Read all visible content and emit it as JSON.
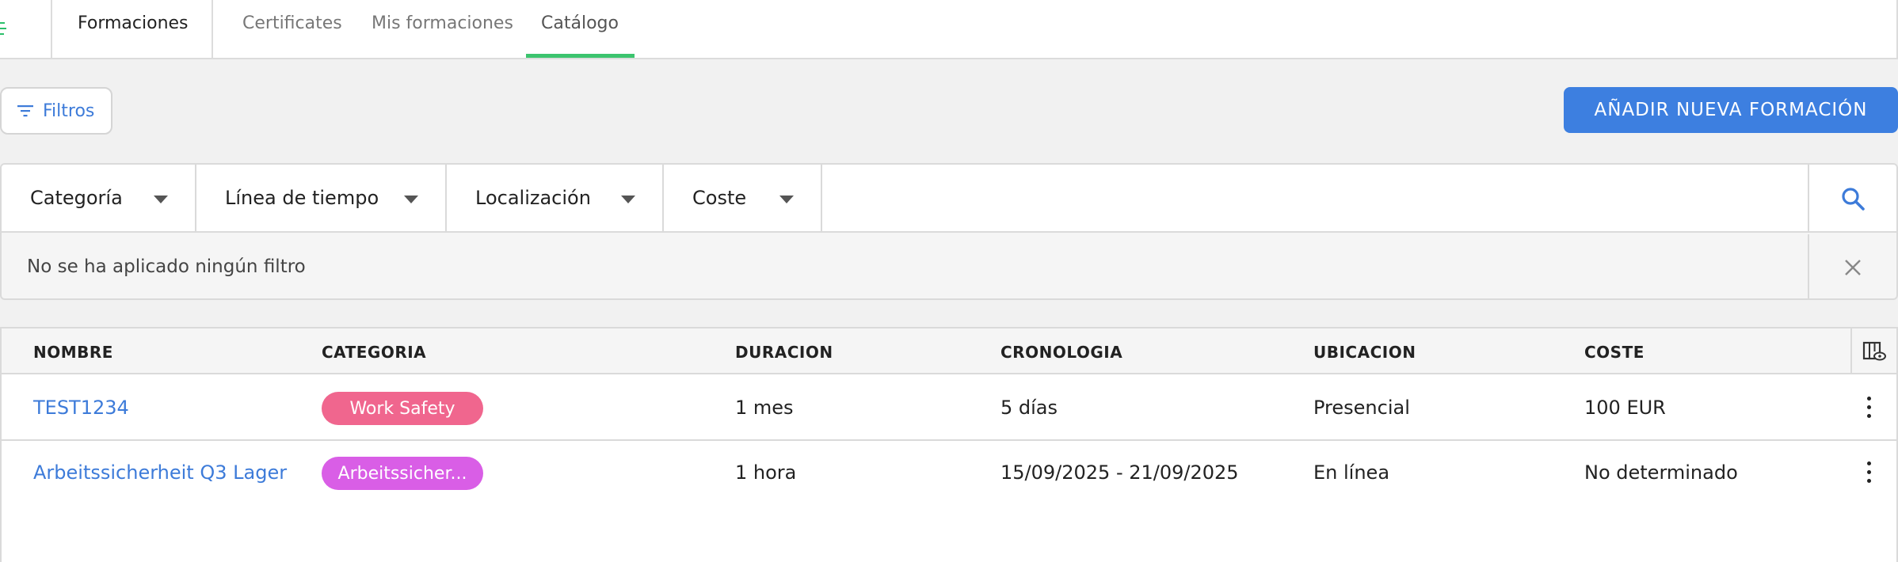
{
  "nav": {
    "section_title": "Formaciones",
    "tabs": [
      {
        "label": "Certificates"
      },
      {
        "label": "Mis formaciones"
      },
      {
        "label": "Catálogo",
        "active": true
      }
    ]
  },
  "toolbar": {
    "filters_label": "Filtros",
    "add_label": "AÑADIR NUEVA FORMACIÓN"
  },
  "filters": {
    "dropdowns": [
      {
        "label": "Categoría"
      },
      {
        "label": "Línea de tiempo"
      },
      {
        "label": "Localización"
      },
      {
        "label": "Coste"
      }
    ],
    "search_value": "",
    "applied_text": "No se ha aplicado ningún filtro"
  },
  "table": {
    "columns": [
      "NOMBRE",
      "CATEGORIA",
      "DURACION",
      "CRONOLOGIA",
      "UBICACION",
      "COSTE"
    ],
    "rows": [
      {
        "name": "TEST1234",
        "category": "Work Safety",
        "category_color": "#f0668e",
        "duration": "1 mes",
        "timeline": "5 días",
        "location": "Presencial",
        "cost": "100 EUR"
      },
      {
        "name": "Arbeitssicherheit Q3 Lager",
        "category": "Arbeitssicher...",
        "category_color": "#d95ee6",
        "duration": "1 hora",
        "timeline": "15/09/2025 - 21/09/2025",
        "location": "En línea",
        "cost": "No determinado"
      }
    ]
  },
  "colors": {
    "accent": "#3d7fe0",
    "active_tab": "#3cc46e",
    "link": "#3d7bd9"
  }
}
